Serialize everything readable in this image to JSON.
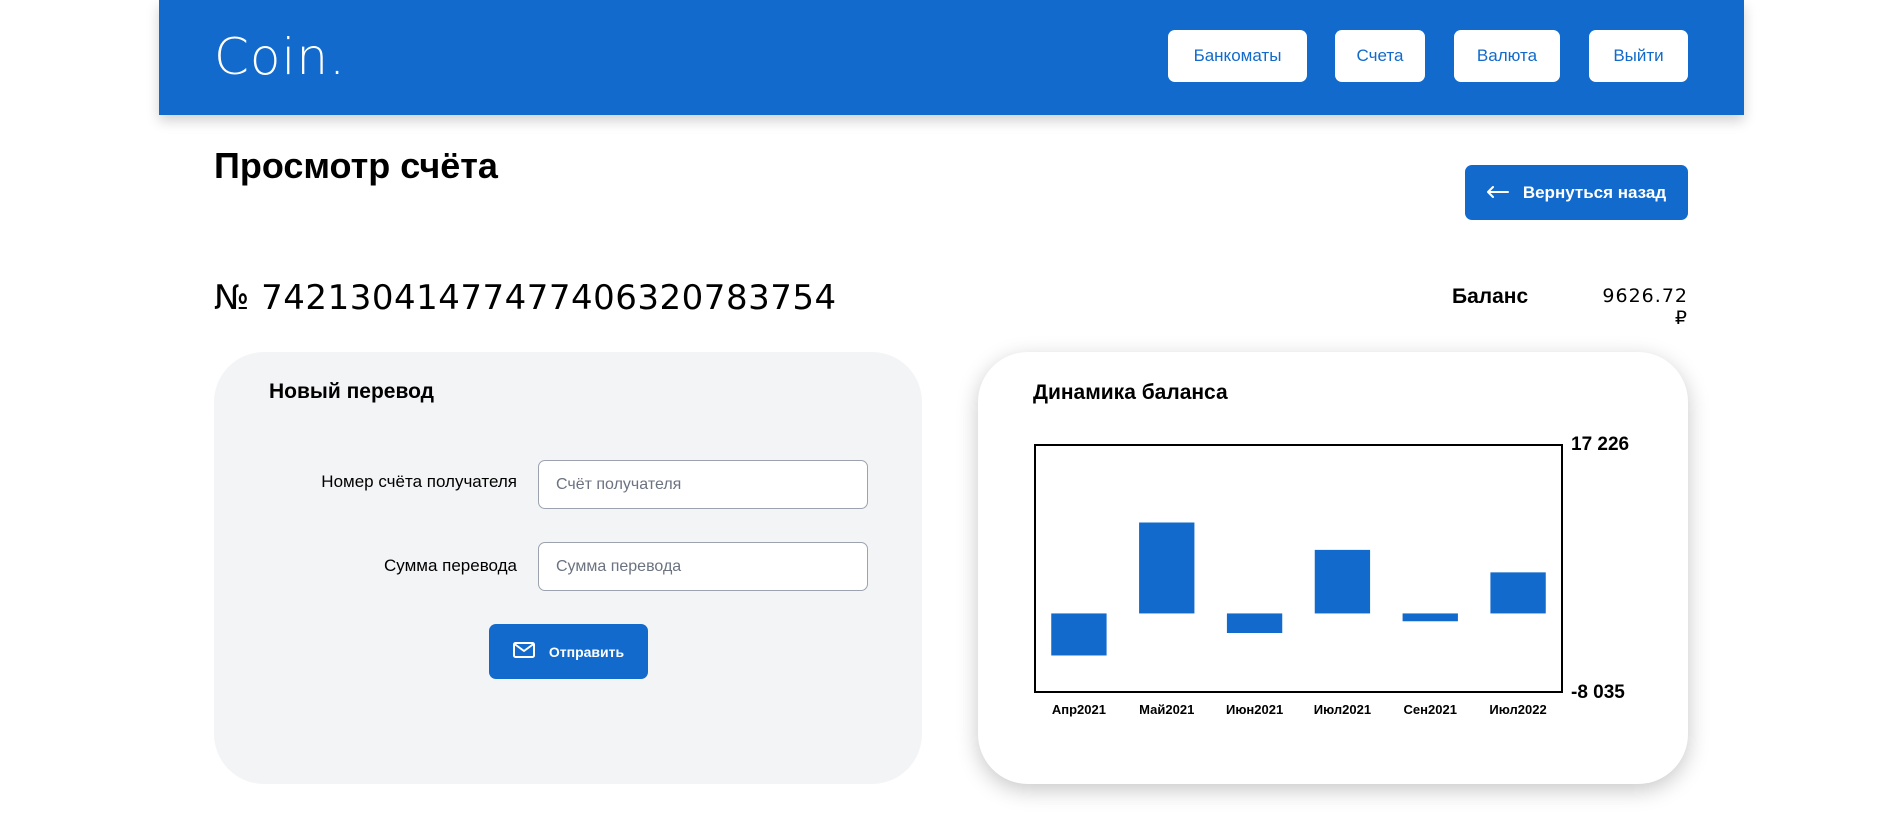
{
  "header": {
    "logo": "Coin.",
    "nav": {
      "atms": "Банкоматы",
      "accounts": "Счета",
      "currency": "Валюта",
      "logout": "Выйти"
    }
  },
  "page": {
    "title": "Просмотр счёта",
    "back_label": "Вернуться назад",
    "account_number": "№ 74213041477477406320783754",
    "balance_label": "Баланс",
    "balance_value": "9626.72 ₽"
  },
  "transfer": {
    "title": "Новый перевод",
    "recipient_label": "Номер счёта получателя",
    "recipient_placeholder": "Счёт получателя",
    "recipient_value": "",
    "amount_label": "Сумма перевода",
    "amount_placeholder": "Сумма перевода",
    "amount_value": "",
    "send_label": "Отправить"
  },
  "icons": {
    "back": "arrow-left-icon",
    "send": "mail-icon"
  },
  "colors": {
    "primary": "#116ACC",
    "card_bg": "#F3F4F6"
  },
  "chart_data": {
    "type": "bar",
    "title": "Динамика баланса",
    "categories": [
      "Апр2021",
      "Май2021",
      "Июн2021",
      "Июл2021",
      "Сен2021",
      "Июл2022"
    ],
    "values": [
      -4300,
      9300,
      -2000,
      6500,
      -800,
      4200
    ],
    "ylim": [
      -8035,
      17226
    ],
    "ytick_labels": [
      "17 226",
      "-8 035"
    ],
    "grid": false
  }
}
